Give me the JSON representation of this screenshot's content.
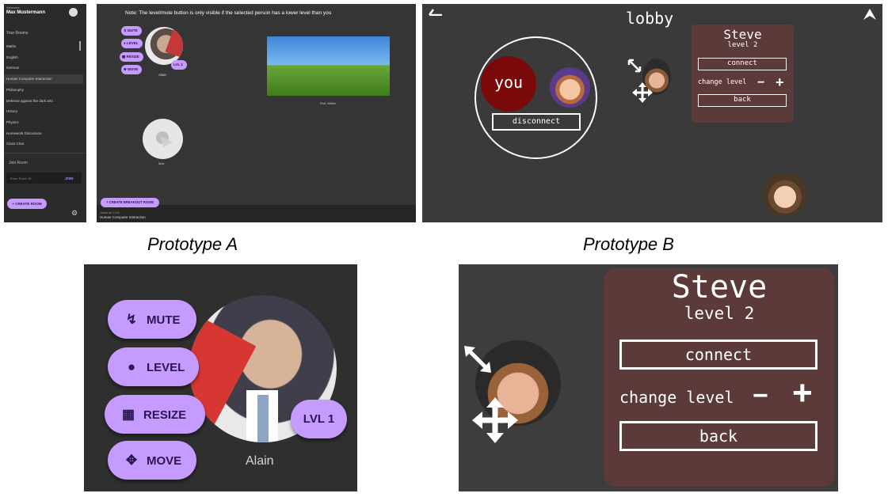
{
  "captions": {
    "a": "Prototype A",
    "b": "Prototype B"
  },
  "proto_a": {
    "sidebar": {
      "user_small": "Welcome",
      "user_name": "Max Mustermann",
      "your_rooms": "Your Rooms",
      "rooms": [
        "Maths",
        "English",
        "German",
        "Human Computer Interaction",
        "Philosophy",
        "Defense against the dark arts",
        "History",
        "Physics",
        "Homework Discussion",
        "Class Chat"
      ],
      "active_room_index": 3,
      "join_rooms": "Join Room",
      "join_placeholder": "Enter Room ID...",
      "join_button": "JOIN",
      "create_room": "+  CREATE ROOM",
      "gear_icon": "gear-icon"
    },
    "main": {
      "note": "Note: The level/mute button is only visible if the selected person has a lower level than you",
      "controls": {
        "mute": "MUTE",
        "level": "LEVEL",
        "resize": "RESIZE",
        "move": "MOVE"
      },
      "lvl_badge": "LVL 1",
      "person_name": "Alain",
      "window_caption": "Prof. Müller",
      "max_caption": "Max",
      "breakout_button": "+  CREATE BREAKOUT ROOM",
      "bottom_small": "Joined as: 1234",
      "bottom_room": "Human Computer Interaction"
    }
  },
  "proto_b": {
    "title": "lobby",
    "you_label": "you",
    "disconnect": "disconnect",
    "card": {
      "name": "Steve",
      "level": "level 2",
      "connect": "connect",
      "change_level": "change level",
      "minus": "−",
      "plus": "+",
      "back": "back"
    }
  },
  "zoom_a": {
    "controls": {
      "mute": "MUTE",
      "level": "LEVEL",
      "resize": "RESIZE",
      "move": "MOVE"
    },
    "icons": {
      "mute": "mic-off-icon",
      "level": "people-icon",
      "resize": "resize-icon",
      "move": "move-icon"
    },
    "lvl_badge": "LVL 1",
    "person_name": "Alain"
  },
  "zoom_b": {
    "name": "Steve",
    "level": "level 2",
    "connect": "connect",
    "change_level": "change level",
    "minus": "−",
    "plus": "+",
    "back": "back"
  },
  "colors": {
    "accent": "#c59bff",
    "card": "#5d3a3a",
    "you": "#7a0a0a"
  }
}
